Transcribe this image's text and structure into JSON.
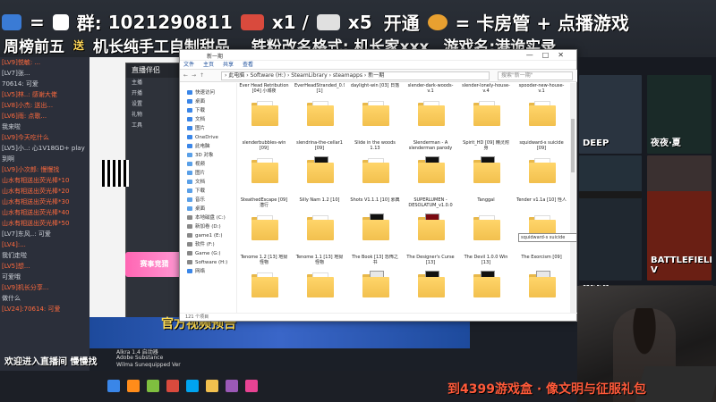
{
  "banner": {
    "line1_prefix": "=",
    "group_label": "群:",
    "group_number": "1021290811",
    "plane_count": "x1",
    "slash": "/",
    "jet_count": "x5",
    "open": "开通",
    "card_manager": "= 卡房管 + 点播游戏",
    "line2": "周榜前五",
    "send": "送",
    "gift": "机长纯手工自制甜品",
    "fan_format": "铁粉改名格式: 机长家xxx",
    "game_name": "游戏名:港诡实录"
  },
  "chat": {
    "messages": [
      {
        "text": "[LV9]悦敏: ...",
        "style": "red"
      },
      {
        "text": "[LV7]张...",
        "style": "gray"
      },
      {
        "text": "70614: 可爱",
        "style": "gray"
      },
      {
        "text": "[LV5]林..: 感谢大佬",
        "style": "red"
      },
      {
        "text": "[LV8]小杰: 送出...",
        "style": "red"
      },
      {
        "text": "[LV6]雨: 点歌...",
        "style": "red"
      },
      {
        "text": "我来啦",
        "style": "gray"
      },
      {
        "text": "[LV9]今天吃什么",
        "style": "red"
      },
      {
        "text": "[LV5]小..: 心1V18GD+ play",
        "style": "gray"
      },
      {
        "text": "到啊",
        "style": "gray"
      },
      {
        "text": "[LV9]小次郎: 慢慢找",
        "style": "red"
      },
      {
        "text": "山水有相送出荧光棒*10",
        "style": "red"
      },
      {
        "text": "山水有相送出荧光棒*20",
        "style": "red"
      },
      {
        "text": "山水有相送出荧光棒*30",
        "style": "red"
      },
      {
        "text": "山水有相送出荧光棒*40",
        "style": "red"
      },
      {
        "text": "山水有相送出荧光棒*50",
        "style": "red"
      },
      {
        "text": "[LV7]东风..: 可爱",
        "style": "gray"
      },
      {
        "text": "[LV4]:...",
        "style": "red"
      },
      {
        "text": "我们走啦",
        "style": "gray"
      },
      {
        "text": "[LV5]想...",
        "style": "red"
      },
      {
        "text": "可爱哦",
        "style": "gray"
      },
      {
        "text": "[LV9]机长分享...",
        "style": "red"
      },
      {
        "text": "做什么",
        "style": "gray"
      },
      {
        "text": "[LV24]:70614: 可爱",
        "style": "red"
      }
    ]
  },
  "streamapp": {
    "title": "直播伴侣",
    "items": [
      "主播",
      "开播",
      "设置",
      "礼物",
      "工具"
    ],
    "promo": "赛事竞猜"
  },
  "promo_strip": "官方视频预告",
  "explorer": {
    "title": "新一期",
    "ribbon": [
      "文件",
      "主页",
      "共享",
      "查看"
    ],
    "path": "› 此电脑 › Software (H:) › SteamLibrary › steamapps › 新一期",
    "search_placeholder": "搜索\"新一期\"",
    "nav": [
      {
        "label": "快速访问",
        "color": "#3a86e8"
      },
      {
        "label": "桌面",
        "color": "#3a86e8"
      },
      {
        "label": "下载",
        "color": "#3a86e8"
      },
      {
        "label": "文档",
        "color": "#3a86e8"
      },
      {
        "label": "图片",
        "color": "#3a86e8"
      },
      {
        "label": "OneDrive",
        "color": "#3a86e8"
      },
      {
        "label": "此电脑",
        "color": "#3a86e8"
      },
      {
        "label": "3D 对象",
        "color": "#5aa0e8"
      },
      {
        "label": "视频",
        "color": "#5aa0e8"
      },
      {
        "label": "图片",
        "color": "#5aa0e8"
      },
      {
        "label": "文档",
        "color": "#5aa0e8"
      },
      {
        "label": "下载",
        "color": "#5aa0e8"
      },
      {
        "label": "音乐",
        "color": "#5aa0e8"
      },
      {
        "label": "桌面",
        "color": "#5aa0e8"
      },
      {
        "label": "本地磁盘 (C:)",
        "color": "#888888"
      },
      {
        "label": "新加卷 (D:)",
        "color": "#888888"
      },
      {
        "label": "game1 (E:)",
        "color": "#888888"
      },
      {
        "label": "软件 (F:)",
        "color": "#888888"
      },
      {
        "label": "Game (G:)",
        "color": "#888888"
      },
      {
        "label": "Software (H:)",
        "color": "#888888"
      },
      {
        "label": "网络",
        "color": "#3a86e8"
      }
    ],
    "items": [
      {
        "label": "Ever Head Retribution [04] 小城夜",
        "kind": "folder"
      },
      {
        "label": "EverHeadStranded_0.9.7 [1]",
        "kind": "folder"
      },
      {
        "label": "daylight-win [03] 日落",
        "kind": "folder"
      },
      {
        "label": "slender-dark-woods-v.1",
        "kind": "folder"
      },
      {
        "label": "slender-lonely-house-v.4",
        "kind": "folder"
      },
      {
        "label": "spooder-new-house-v.1",
        "kind": "folder"
      },
      {
        "label": "slenderbubbles-win [09]",
        "kind": "folder"
      },
      {
        "label": "slendrina-the-cellar1 [09]",
        "kind": "art-dark"
      },
      {
        "label": "Slide in the woods 1.13",
        "kind": "folder"
      },
      {
        "label": "Slenderman - A slenderman parody",
        "kind": "art-dark"
      },
      {
        "label": "Spirit_HD [09] 精灵附身",
        "kind": "art-dark"
      },
      {
        "label": "squidward-s suicide [09]",
        "kind": "folder"
      },
      {
        "label": "SteathedEscape [09] 潜行",
        "kind": "folder"
      },
      {
        "label": "Silly Nam 1.2 [10]",
        "kind": "folder"
      },
      {
        "label": "Shots V1.1.1 [10] 邪典",
        "kind": "art-dark"
      },
      {
        "label": "SUPERLUMEN - DESOLATUM_v1.0.0",
        "kind": "art-red"
      },
      {
        "label": "Tanggal",
        "kind": "folder"
      },
      {
        "label": "Tender v1.1a [10] 怪人",
        "kind": "folder"
      },
      {
        "label": "Tenome 1.2 [13] 地狱怪物",
        "kind": "folder"
      },
      {
        "label": "Tenome 1.1 [13] 地狱怪物",
        "kind": "folder"
      },
      {
        "label": "The Book [13] 恐怖之书",
        "kind": "art-light"
      },
      {
        "label": "The Designer's Curse [13]",
        "kind": "art-dark"
      },
      {
        "label": "The Devil 1.0.0 Win [13]",
        "kind": "art-dark"
      },
      {
        "label": "The Exorcism [09]",
        "kind": "art-light"
      }
    ],
    "status": "121 个项目",
    "tooltip": "squidward-s suicide"
  },
  "steam": {
    "cards": [
      "DEEP",
      "夜夜·夏",
      "DEEP",
      "AFTERM",
      "",
      "BATTLEFIELD V",
      "SEPTEMBER 1999",
      "DEEP"
    ]
  },
  "taskbar": {
    "items": [
      "Alkra 1.4 启动器",
      "Adobe Substance",
      "Wilma Sunequipped Ver"
    ]
  },
  "ticker": "到4399游戏盒 · 像文明与征服礼包",
  "overlay_bottom_left": "欢迎进入直播间 慢慢找"
}
